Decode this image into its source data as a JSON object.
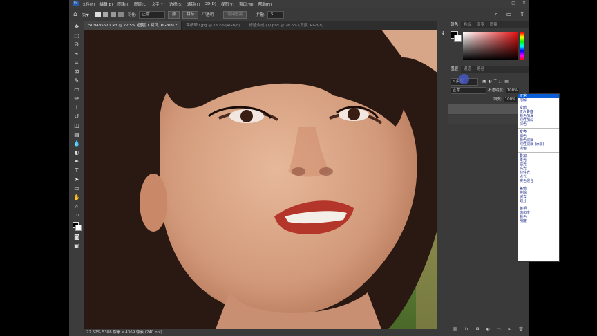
{
  "menubar": {
    "logo": "Ps",
    "items": [
      "文件(F)",
      "编辑(E)",
      "图像(I)",
      "图层(L)",
      "文字(Y)",
      "选择(S)",
      "滤镜(T)",
      "3D(D)",
      "视图(V)",
      "窗口(W)",
      "帮助(H)"
    ],
    "window_buttons": [
      "—",
      "▢",
      "✕"
    ]
  },
  "options": {
    "feather_label": "羽化:",
    "blend_mode": "正常",
    "btn_source": "源",
    "btn_target": "目标",
    "transparent_label": "透明",
    "use_pattern": "使用图案",
    "diffusion_label": "扩散:",
    "diffusion_value": "5"
  },
  "tabs": [
    {
      "label": "5U9A8567.CR3 @ 72.5% (图层 1 拷贝, RGB/8) *",
      "active": true
    },
    {
      "label": "蒋纸带0.jpg @ 16.6%(RGB/8)",
      "active": false
    },
    {
      "label": "修脸合成 (1).psd @ 26.6% (背景, RGB/8)",
      "active": false
    }
  ],
  "statusbar": {
    "text": "72.52% 5386 像素 x 4369 像素 (240 ppi)"
  },
  "color_panel": {
    "tabs": [
      "颜色",
      "色板",
      "渐变",
      "图案"
    ],
    "active": 0
  },
  "layers_panel": {
    "tabs": [
      "图层",
      "通道",
      "路径"
    ],
    "active": 0,
    "filter_label": "类型",
    "blend_mode": "正常",
    "opacity_label": "不透明度:",
    "opacity_value": "100%",
    "fill_label": "填充:",
    "fill_value": "100%"
  },
  "blend_dropdown": {
    "groups": [
      [
        "正常",
        "溶解"
      ],
      [
        "变暗",
        "正片叠底",
        "颜色加深",
        "线性加深",
        "深色"
      ],
      [
        "变亮",
        "滤色",
        "颜色减淡",
        "线性减淡 (添加)",
        "浅色"
      ],
      [
        "叠加",
        "柔光",
        "强光",
        "亮光",
        "线性光",
        "点光",
        "实色混合"
      ],
      [
        "差值",
        "排除",
        "减去",
        "划分"
      ],
      [
        "色相",
        "饱和度",
        "颜色",
        "明度"
      ]
    ],
    "selected": "正常"
  },
  "colors": {
    "accent": "#0b5fd6",
    "app_bg": "#535353",
    "panel_bg": "#3a3a3a"
  }
}
